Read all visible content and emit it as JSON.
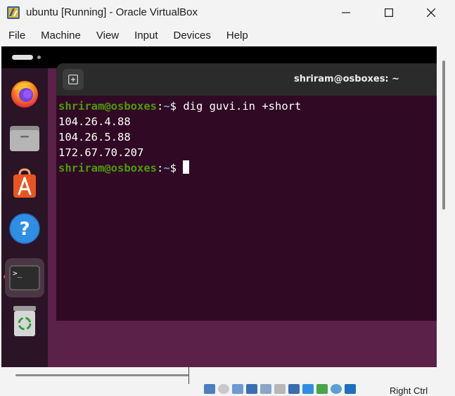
{
  "window": {
    "title": "ubuntu [Running] - Oracle VirtualBox",
    "controls": [
      "minimize-icon",
      "maximize-icon",
      "close-icon"
    ]
  },
  "menu": {
    "items": [
      "File",
      "Machine",
      "View",
      "Input",
      "Devices",
      "Help"
    ]
  },
  "dock": {
    "apps": [
      "firefox-icon",
      "files-icon",
      "app-center-icon",
      "help-icon",
      "terminal-icon",
      "trash-icon"
    ],
    "active_app": "terminal-icon"
  },
  "terminal": {
    "title": "shriram@osboxes: ~",
    "prompt_user": "shriram@osboxes",
    "prompt_sep": ":",
    "prompt_path": "~",
    "prompt_symbol": "$ ",
    "command": "dig guvi.in +short",
    "output": [
      "104.26.4.88",
      "104.26.5.88",
      "172.67.70.207"
    ]
  },
  "statusbar": {
    "host_key": "Right Ctrl",
    "icons": [
      "hard-disk-icon",
      "optical-drive-icon",
      "audio-icon",
      "network-icon",
      "usb-icon",
      "shared-folders-icon",
      "display-icon",
      "recording-icon",
      "cpu-icon",
      "mouse-integration-icon",
      "keyboard-icon"
    ]
  },
  "colors": {
    "desktop_bg": "#5b2148",
    "terminal_bg": "#300a24",
    "prompt_user": "#4e9a06",
    "prompt_path": "#729fcf",
    "accent_orange": "#e95420"
  }
}
